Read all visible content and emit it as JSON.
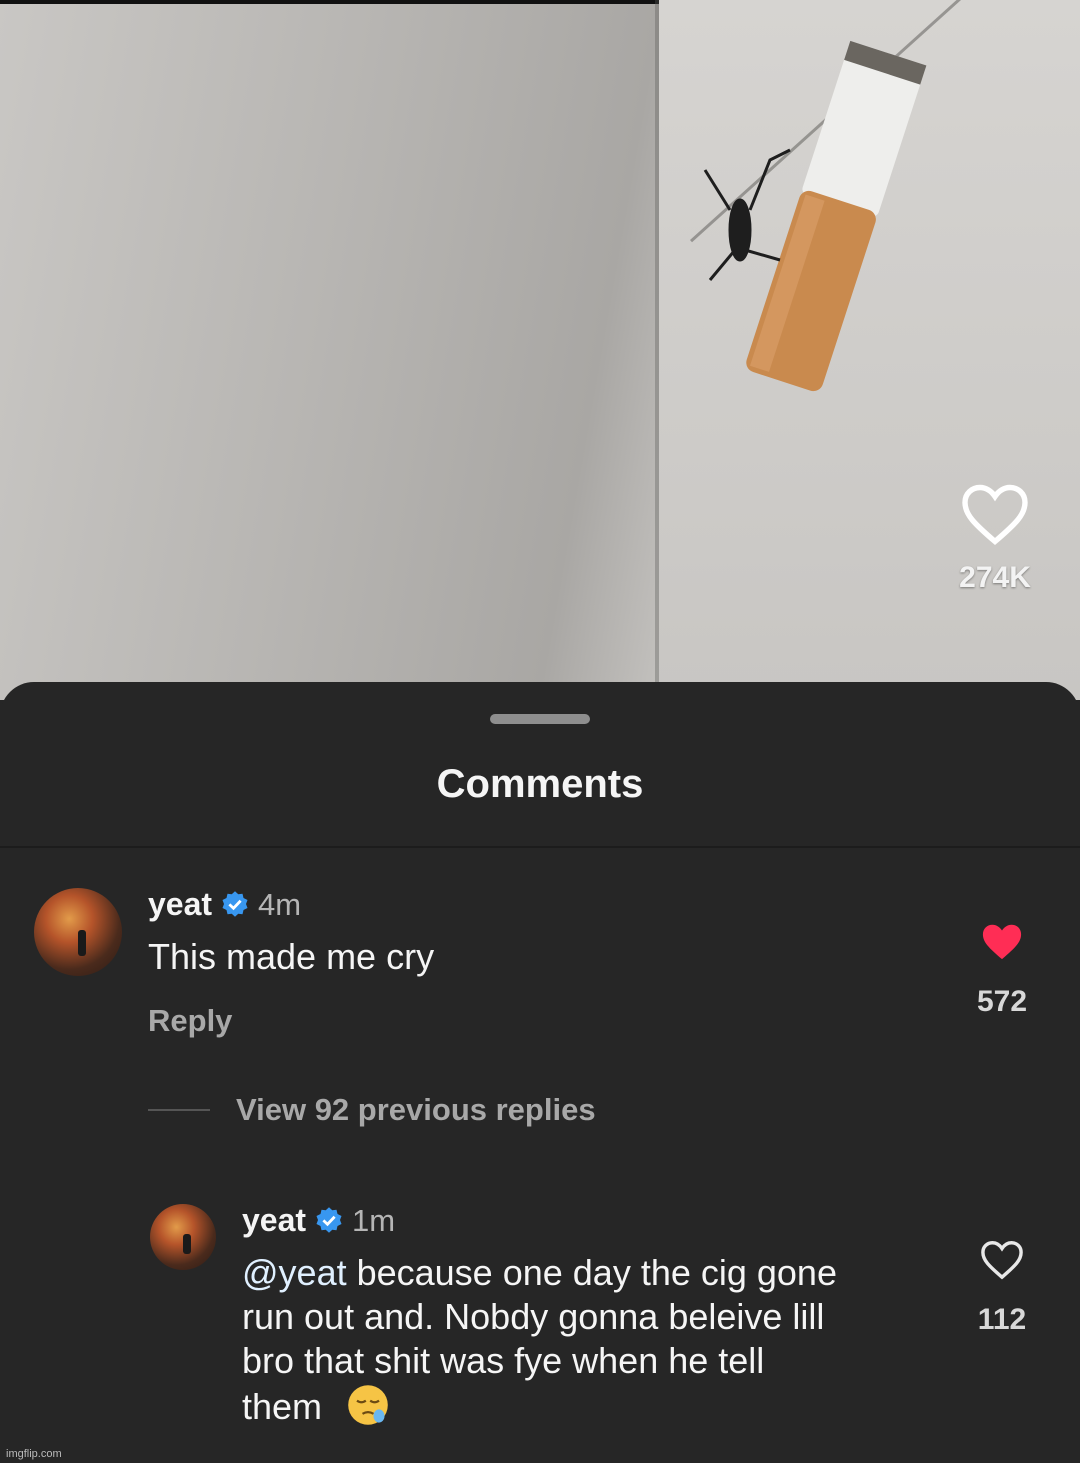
{
  "video": {
    "like_count": "274K"
  },
  "sheet": {
    "title": "Comments"
  },
  "comments": [
    {
      "username": "yeat",
      "time": "4m",
      "text": "This made me cry",
      "reply_label": "Reply",
      "like_count": "572",
      "liked": true
    }
  ],
  "view_replies_label": "View 92 previous replies",
  "replies": [
    {
      "username": "yeat",
      "time": "1m",
      "mention": "@yeat",
      "text_lines": [
        " because one day the cig gone",
        "run out and. Nobdy gonna beleive lill",
        "bro that shit was fye when he tell",
        "them"
      ],
      "like_count": "112",
      "liked": false
    }
  ],
  "watermark": "imgflip.com",
  "colors": {
    "sheet_bg": "#262626",
    "liked_heart": "#ff2d55",
    "verified": "#3897f0"
  }
}
